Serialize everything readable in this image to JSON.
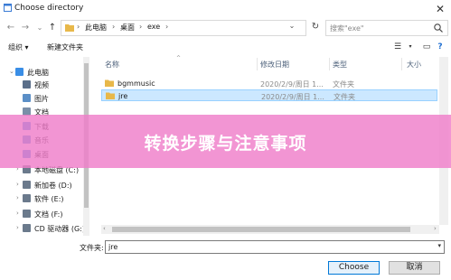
{
  "window": {
    "title": "Choose directory"
  },
  "address": {
    "crumbs": [
      "此电脑",
      "桌面",
      "exe"
    ],
    "search_placeholder": "搜索\"exe\""
  },
  "toolbar": {
    "organize": "组织 ▾",
    "new_folder": "新建文件夹"
  },
  "nav": {
    "items": [
      {
        "label": "此电脑",
        "icon": "computer-icon",
        "color": "#3a8ee6"
      },
      {
        "label": "视频",
        "icon": "video-folder-icon",
        "color": "#5b6f8a"
      },
      {
        "label": "图片",
        "icon": "pictures-folder-icon",
        "color": "#5b8fc7"
      },
      {
        "label": "文档",
        "icon": "documents-folder-icon",
        "color": "#7a8fa8"
      },
      {
        "label": "下载",
        "icon": "downloads-folder-icon",
        "color": "#3a8ee6"
      },
      {
        "label": "音乐",
        "icon": "music-folder-icon",
        "color": "#4a90d9"
      },
      {
        "label": "桌面",
        "icon": "desktop-folder-icon",
        "color": "#3a8ee6"
      },
      {
        "label": "本地磁盘 (C:)",
        "icon": "drive-icon",
        "color": "#6b7a8c"
      },
      {
        "label": "新加卷 (D:)",
        "icon": "drive-icon",
        "color": "#6b7a8c"
      },
      {
        "label": "软件 (E:)",
        "icon": "drive-icon",
        "color": "#6b7a8c"
      },
      {
        "label": "文档 (F:)",
        "icon": "drive-icon",
        "color": "#6b7a8c"
      },
      {
        "label": "CD 驱动器 (G:)",
        "icon": "cd-drive-icon",
        "color": "#6b7a8c"
      }
    ]
  },
  "list": {
    "headers": {
      "name": "名称",
      "modified": "修改日期",
      "type": "类型",
      "size": "大小"
    },
    "rows": [
      {
        "name": "bgmmusic",
        "modified": "2020/2/9/周日 1...",
        "type": "文件夹",
        "selected": false
      },
      {
        "name": "jre",
        "modified": "2020/2/9/周日 1...",
        "type": "文件夹",
        "selected": true
      }
    ]
  },
  "footer": {
    "filename_label": "文件夹:",
    "filename_value": "jre",
    "choose_label": "Choose",
    "cancel_label": "取消"
  },
  "banner": {
    "text": "转换步骤与注意事项",
    "color": "#ef7ec9"
  }
}
